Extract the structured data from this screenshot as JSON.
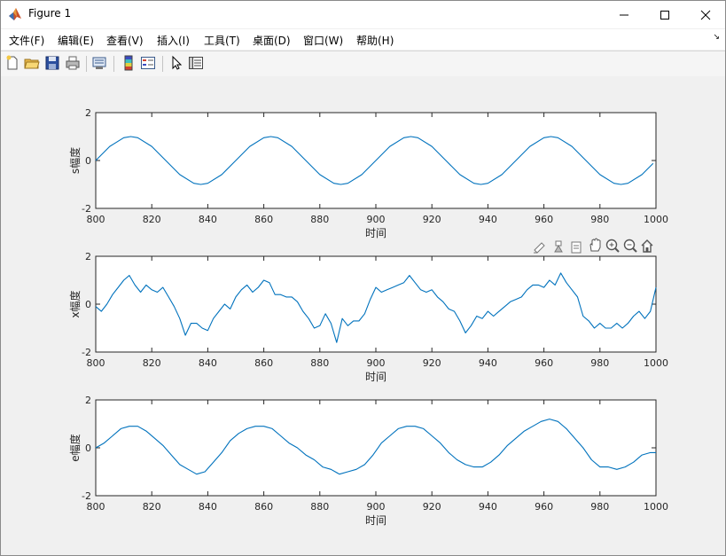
{
  "window": {
    "title": "Figure 1"
  },
  "menu": [
    "文件(F)",
    "编辑(E)",
    "查看(V)",
    "插入(I)",
    "工具(T)",
    "桌面(D)",
    "窗口(W)",
    "帮助(H)"
  ],
  "menu_corner": "↘",
  "toolbar": [
    "new-figure-icon",
    "open-file-icon",
    "save-icon",
    "print-icon",
    "print-preview-icon",
    "insert-colorbar-icon",
    "insert-legend-icon",
    "edit-plot-icon",
    "property-editor-icon"
  ],
  "axes_toolbar": [
    "brush-icon",
    "data-cursor-icon",
    "link-icon",
    "pan-icon",
    "zoom-in-icon",
    "zoom-out-icon",
    "home-icon"
  ],
  "colors": {
    "line": "#0072bd"
  },
  "chart_data": [
    {
      "type": "line",
      "xlabel": "时间",
      "ylabel": "s幅度",
      "xlim": [
        800,
        1000
      ],
      "ylim": [
        -2,
        2
      ],
      "xticks": [
        "800",
        "820",
        "840",
        "860",
        "880",
        "900",
        "920",
        "940",
        "960",
        "980",
        "1000"
      ],
      "yticks": [
        "-2",
        "0",
        "2"
      ],
      "x": [
        800,
        805,
        810,
        812.5,
        815,
        820,
        825,
        830,
        835,
        837.5,
        840,
        845,
        850,
        855,
        860,
        862.5,
        865,
        870,
        875,
        880,
        885,
        887.5,
        890,
        895,
        900,
        905,
        910,
        912.5,
        915,
        920,
        925,
        930,
        935,
        937.5,
        940,
        945,
        950,
        955,
        960,
        962.5,
        965,
        970,
        975,
        980,
        985,
        987.5,
        990,
        995,
        999
      ],
      "y": [
        0.0,
        0.59,
        0.95,
        1.0,
        0.95,
        0.59,
        0.0,
        -0.59,
        -0.95,
        -1.0,
        -0.95,
        -0.59,
        0.0,
        0.59,
        0.95,
        1.0,
        0.95,
        0.59,
        0.0,
        -0.59,
        -0.95,
        -1.0,
        -0.95,
        -0.59,
        0.0,
        0.59,
        0.95,
        1.0,
        0.95,
        0.59,
        0.0,
        -0.59,
        -0.95,
        -1.0,
        -0.95,
        -0.59,
        0.0,
        0.59,
        0.95,
        1.0,
        0.95,
        0.59,
        0.0,
        -0.59,
        -0.95,
        -1.0,
        -0.95,
        -0.59,
        -0.12
      ]
    },
    {
      "type": "line",
      "xlabel": "时间",
      "ylabel": "x幅度",
      "xlim": [
        800,
        1000
      ],
      "ylim": [
        -2,
        2
      ],
      "xticks": [
        "800",
        "820",
        "840",
        "860",
        "880",
        "900",
        "920",
        "940",
        "960",
        "980",
        "1000"
      ],
      "yticks": [
        "-2",
        "0",
        "2"
      ],
      "x": [
        800,
        802,
        804,
        806,
        808,
        810,
        812,
        814,
        816,
        818,
        820,
        822,
        824,
        826,
        828,
        830,
        832,
        834,
        836,
        838,
        840,
        842,
        844,
        846,
        848,
        850,
        852,
        854,
        856,
        858,
        860,
        862,
        864,
        866,
        868,
        870,
        872,
        874,
        876,
        878,
        880,
        882,
        884,
        886,
        888,
        890,
        892,
        894,
        896,
        898,
        900,
        902,
        904,
        906,
        908,
        910,
        912,
        914,
        916,
        918,
        920,
        922,
        924,
        926,
        928,
        930,
        932,
        934,
        936,
        938,
        940,
        942,
        944,
        946,
        948,
        950,
        952,
        954,
        956,
        958,
        960,
        962,
        964,
        966,
        968,
        970,
        972,
        974,
        976,
        978,
        980,
        982,
        984,
        986,
        988,
        990,
        992,
        994,
        996,
        998,
        1000
      ],
      "y": [
        -0.1,
        -0.3,
        0.0,
        0.4,
        0.7,
        1.0,
        1.2,
        0.8,
        0.5,
        0.8,
        0.6,
        0.5,
        0.7,
        0.3,
        -0.1,
        -0.6,
        -1.3,
        -0.8,
        -0.8,
        -1.0,
        -1.1,
        -0.6,
        -0.3,
        0.0,
        -0.2,
        0.3,
        0.6,
        0.8,
        0.5,
        0.7,
        1.0,
        0.9,
        0.4,
        0.4,
        0.3,
        0.3,
        0.1,
        -0.3,
        -0.6,
        -1.0,
        -0.9,
        -0.4,
        -0.8,
        -1.6,
        -0.6,
        -0.9,
        -0.7,
        -0.7,
        -0.4,
        0.2,
        0.7,
        0.5,
        0.6,
        0.7,
        0.8,
        0.9,
        1.2,
        0.9,
        0.6,
        0.5,
        0.6,
        0.3,
        0.1,
        -0.2,
        -0.3,
        -0.7,
        -1.2,
        -0.9,
        -0.5,
        -0.6,
        -0.3,
        -0.5,
        -0.3,
        -0.1,
        0.1,
        0.2,
        0.3,
        0.6,
        0.8,
        0.8,
        0.7,
        1.0,
        0.8,
        1.3,
        0.9,
        0.6,
        0.3,
        -0.5,
        -0.7,
        -1.0,
        -0.8,
        -1.0,
        -1.0,
        -0.8,
        -1.0,
        -0.8,
        -0.5,
        -0.3,
        -0.6,
        -0.3,
        0.7
      ]
    },
    {
      "type": "line",
      "xlabel": "时间",
      "ylabel": "e幅度",
      "xlim": [
        800,
        1000
      ],
      "ylim": [
        -2,
        2
      ],
      "xticks": [
        "800",
        "820",
        "840",
        "860",
        "880",
        "900",
        "920",
        "940",
        "960",
        "980",
        "1000"
      ],
      "yticks": [
        "-2",
        "0",
        "2"
      ],
      "x": [
        800,
        803,
        806,
        809,
        812,
        815,
        818,
        821,
        824,
        827,
        830,
        833,
        836,
        839,
        842,
        845,
        848,
        851,
        854,
        857,
        860,
        863,
        866,
        869,
        872,
        875,
        878,
        881,
        884,
        887,
        890,
        893,
        896,
        899,
        902,
        905,
        908,
        911,
        914,
        917,
        920,
        923,
        926,
        929,
        932,
        935,
        938,
        941,
        944,
        947,
        950,
        953,
        956,
        959,
        962,
        965,
        968,
        971,
        974,
        977,
        980,
        983,
        986,
        989,
        992,
        995,
        998,
        1000
      ],
      "y": [
        0.0,
        0.2,
        0.5,
        0.8,
        0.9,
        0.9,
        0.7,
        0.4,
        0.1,
        -0.3,
        -0.7,
        -0.9,
        -1.1,
        -1.0,
        -0.6,
        -0.2,
        0.3,
        0.6,
        0.8,
        0.9,
        0.9,
        0.8,
        0.5,
        0.2,
        0.0,
        -0.3,
        -0.5,
        -0.8,
        -0.9,
        -1.1,
        -1.0,
        -0.9,
        -0.7,
        -0.3,
        0.2,
        0.5,
        0.8,
        0.9,
        0.9,
        0.8,
        0.5,
        0.2,
        -0.2,
        -0.5,
        -0.7,
        -0.8,
        -0.8,
        -0.6,
        -0.3,
        0.1,
        0.4,
        0.7,
        0.9,
        1.1,
        1.2,
        1.1,
        0.8,
        0.4,
        0.0,
        -0.5,
        -0.8,
        -0.8,
        -0.9,
        -0.8,
        -0.6,
        -0.3,
        -0.2,
        -0.2
      ]
    }
  ]
}
